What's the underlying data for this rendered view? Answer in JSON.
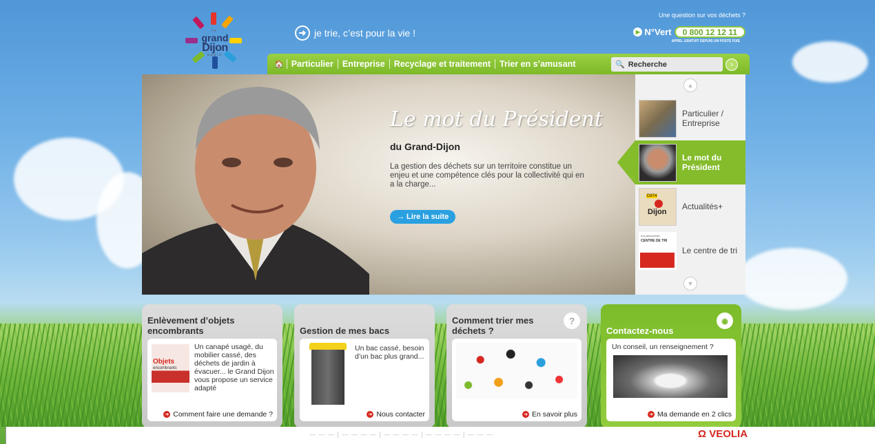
{
  "header": {
    "logo_top": "le",
    "logo_line1": "grand",
    "logo_line2": "Dijon",
    "logo_line3": "agglo",
    "slogan": "je trie, c’est pour la vie !",
    "question": "Une question sur vos déchets ?",
    "vert_label": "N°Vert",
    "vert_number": "0 800 12 12 11",
    "vert_sub": "APPEL GRATUIT DEPUIS UN POSTE FIXE"
  },
  "nav": {
    "items": [
      "Particulier",
      "Entreprise",
      "Recyclage et traitement",
      "Trier en s’amusant"
    ],
    "search_placeholder": "Recherche"
  },
  "hero": {
    "title": "Le mot du Président",
    "subtitle": "du Grand-Dijon",
    "text": "La gestion des déchets sur un territoire constitue un enjeu et une compétence clés pour la collectivité qui en a la charge...",
    "button": "→ Lire la suite"
  },
  "sidebar": {
    "items": [
      {
        "label": "Particulier / Entreprise"
      },
      {
        "label": "Le mot du Président"
      },
      {
        "label": "Actualités+"
      },
      {
        "label": "Le centre de tri"
      }
    ],
    "map_label": "Dijon",
    "map_tag": "D974",
    "tri_tag": "A la découverte",
    "tri_title": "CENTRE DE TRI"
  },
  "boxes": [
    {
      "title": "Enlèvement d’objets encombrants",
      "desc": "Un canapé usagé, du mobilier cassé, des déchets de jardin à évacuer... le Grand Dijon vous propose un service adapté",
      "img_label1": "Objets",
      "img_label2": "encombrants",
      "link": "Comment faire une demande ?"
    },
    {
      "title": "Gestion de mes bacs",
      "desc": "Un bac cassé, besoin d’un bac plus grand...",
      "link": "Nous contacter"
    },
    {
      "title": "Comment trier mes déchets ?",
      "link": "En savoir plus"
    },
    {
      "title": "Contactez-nous",
      "desc": "Un conseil, un renseignement ?",
      "link": "Ma demande en 2 clics"
    }
  ],
  "footer": {
    "veolia": "VEOLIA"
  },
  "colors": {
    "nav_green": "#84bc2b",
    "button_blue": "#2aa0e0",
    "link_red": "#d6281f"
  }
}
